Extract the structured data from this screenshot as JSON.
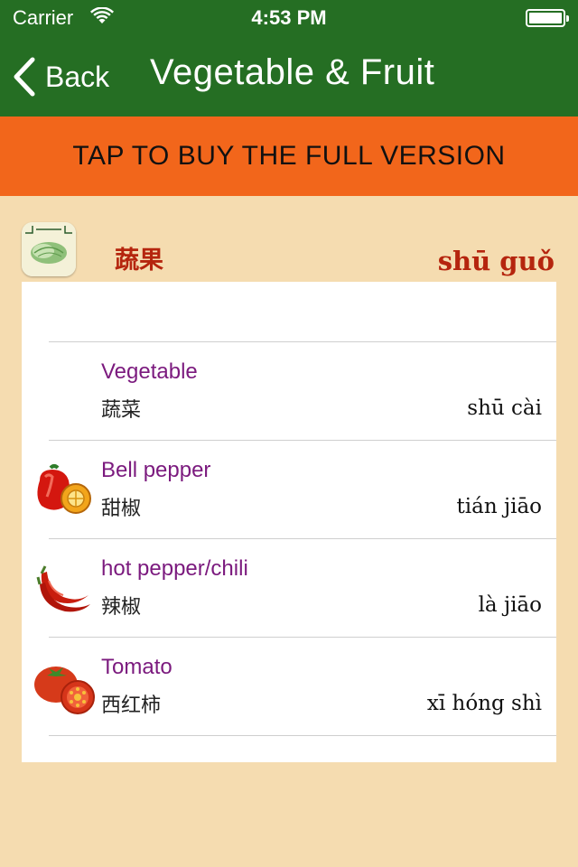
{
  "status_bar": {
    "carrier": "Carrier",
    "time": "4:53 PM"
  },
  "nav": {
    "back_label": "Back",
    "title": "Vegetable & Fruit"
  },
  "buy_banner": "TAP TO BUY THE FULL VERSION",
  "category": {
    "chinese": "蔬果",
    "pinyin": "shū guǒ"
  },
  "items": [
    {
      "english": "Vegetable",
      "chinese": "蔬菜",
      "pinyin": "shū cài",
      "icon": "none"
    },
    {
      "english": "Bell pepper",
      "chinese": "甜椒",
      "pinyin": "tián jiāo",
      "icon": "bell-pepper-icon"
    },
    {
      "english": "hot pepper/chili",
      "chinese": "辣椒",
      "pinyin": "là jiāo",
      "icon": "chili-pepper-icon"
    },
    {
      "english": "Tomato",
      "chinese": "西红柿",
      "pinyin": "xī hóng shì",
      "icon": "tomato-icon"
    }
  ],
  "colors": {
    "nav_green": "#256e23",
    "banner_orange": "#f2661b",
    "background_tan": "#f5dcb0",
    "english_purple": "#7b1a7e",
    "category_red": "#b5250e"
  }
}
